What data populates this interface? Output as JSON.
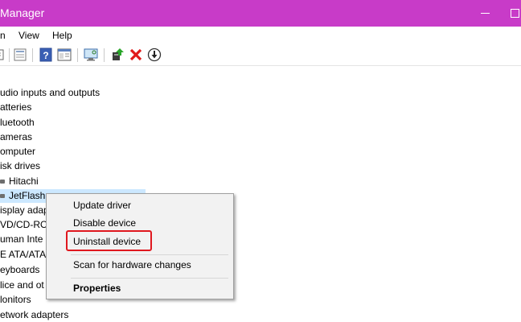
{
  "window": {
    "title": "Manager"
  },
  "menubar": {
    "items": [
      "n",
      "View",
      "Help"
    ]
  },
  "toolbar": {
    "icons": [
      "back-icon",
      "properties-icon",
      "help-icon",
      "show-hidden-icon",
      "scan-hardware-icon",
      "update-driver-icon",
      "uninstall-icon",
      "disable-icon"
    ]
  },
  "tree": {
    "items": [
      "udio inputs and outputs",
      "atteries",
      "luetooth",
      "ameras",
      "omputer",
      "isk drives",
      "Hitachi",
      "JetFlash",
      "isplay adap",
      "VD/CD-RO",
      "uman Inte",
      "E ATA/ATA",
      "eyboards",
      "lice and ot",
      "lonitors",
      "etwork adapters"
    ]
  },
  "context_menu": {
    "items": [
      "Update driver",
      "Disable device",
      "Uninstall device",
      "Scan for hardware changes",
      "Properties"
    ],
    "highlight_color": "#e0181f"
  },
  "colors": {
    "titlebar": "#c83bc8",
    "selection": "#cce8ff"
  }
}
